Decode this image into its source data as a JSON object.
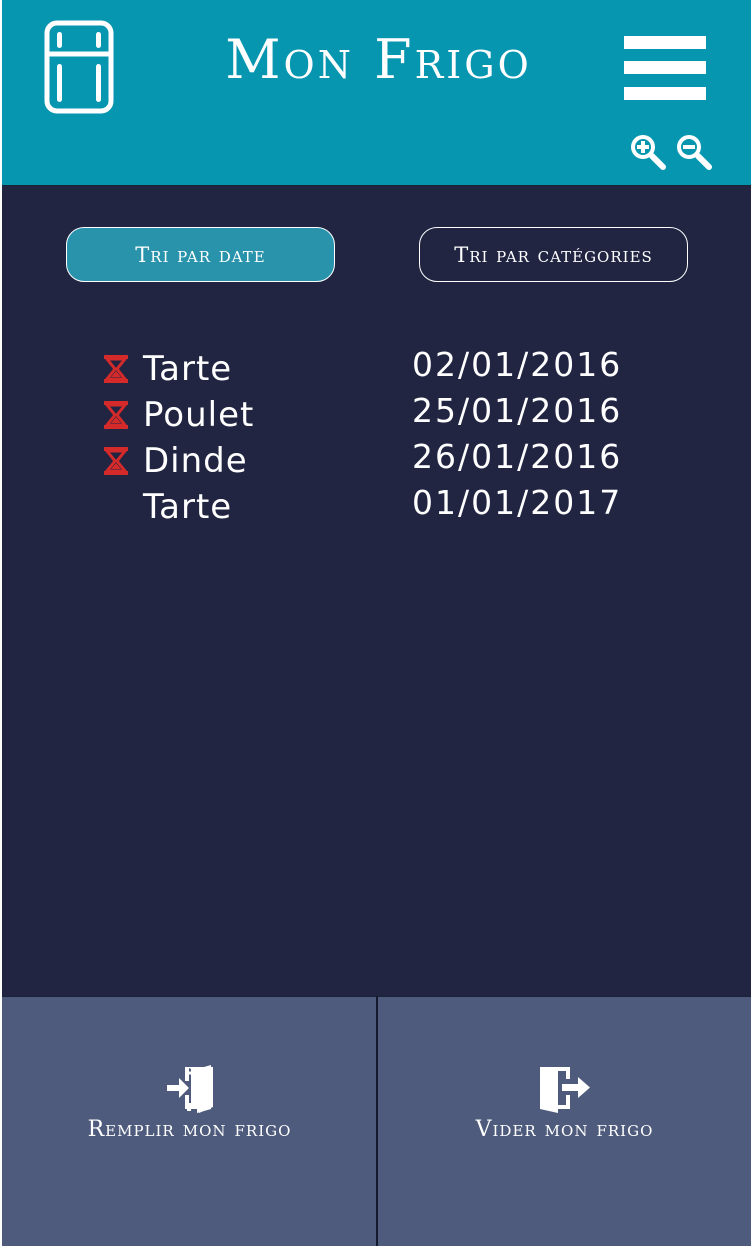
{
  "header": {
    "title": "Mon Frigo",
    "icons": [
      "fridge-icon",
      "hamburger-menu-icon",
      "zoom-in-icon",
      "zoom-out-icon"
    ]
  },
  "sort": {
    "by_date": "Tri par date",
    "by_category": "Tri par catégories"
  },
  "items": [
    {
      "name": "Tarte",
      "date": "02/01/2016",
      "expired": true
    },
    {
      "name": "Poulet",
      "date": "25/01/2016",
      "expired": true
    },
    {
      "name": "Dinde",
      "date": "26/01/2016",
      "expired": true
    },
    {
      "name": "Tarte",
      "date": "01/01/2017",
      "expired": false
    }
  ],
  "footer": {
    "fill_label": "Remplir mon frigo",
    "empty_label": "Vider mon frigo"
  },
  "colors": {
    "header_bg": "#0696b0",
    "main_bg": "#212542",
    "active_sort_bg": "#2893ab",
    "footer_bg": "#4e5b7c",
    "expired_icon": "#d42a2a"
  }
}
